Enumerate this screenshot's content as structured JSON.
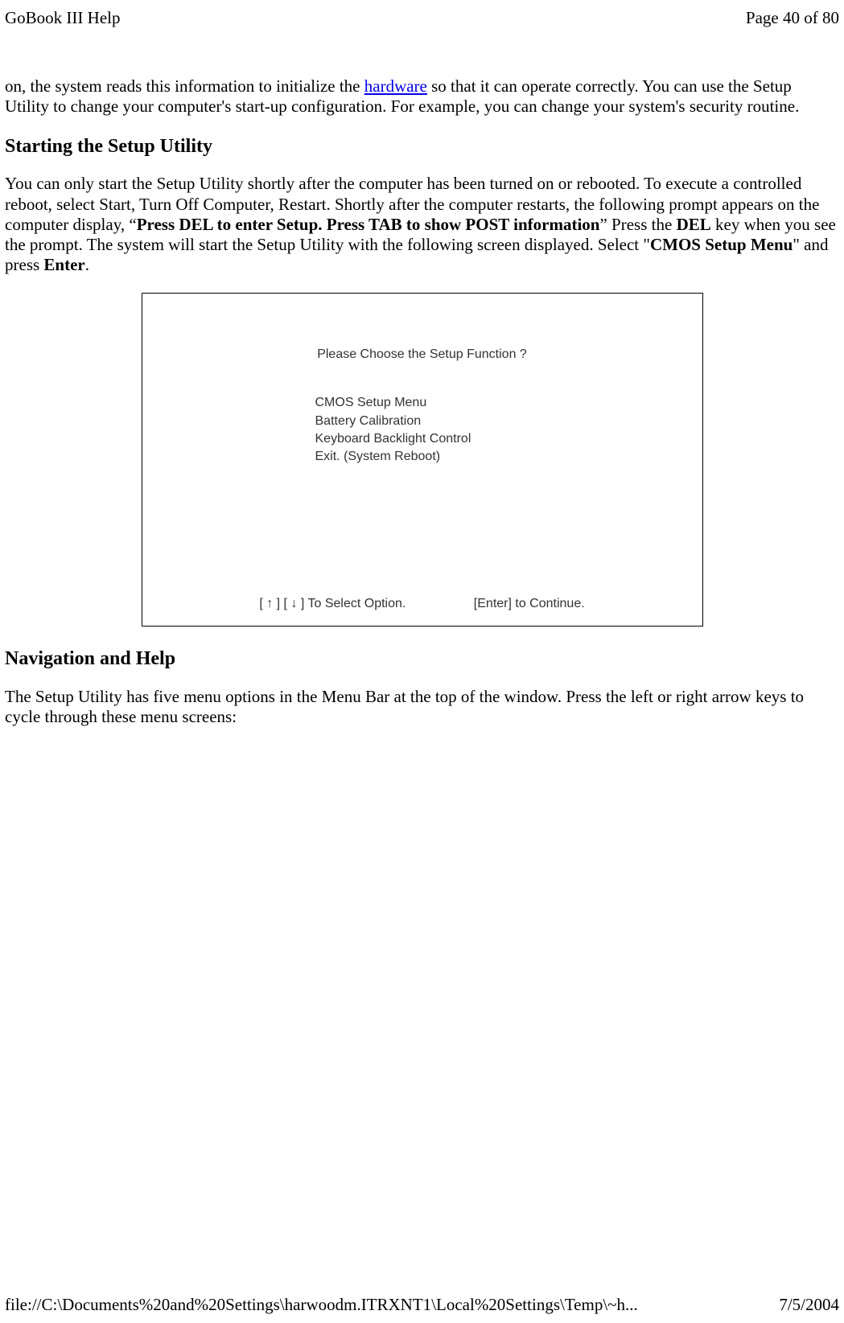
{
  "header": {
    "title": "GoBook III Help",
    "pageinfo": "Page 40 of 80"
  },
  "intro": {
    "text_before_link": "on, the system reads this information to initialize the ",
    "link_text": "hardware",
    "text_after_link": " so that it can operate correctly. You can use the Setup Utility to change your computer's start-up configuration. For example, you can change your system's security routine."
  },
  "section1": {
    "heading": "Starting the Setup Utility",
    "p1_a": "You can only start the Setup Utility shortly after the computer has been turned on or rebooted. To execute a controlled reboot, select Start, Turn Off Computer, Restart.  Shortly after the computer restarts, the following prompt appears on the computer display, “",
    "p1_bold1": "Press DEL to enter Setup. Press TAB to show POST information",
    "p1_b": "”  Press the ",
    "p1_bold2": "DEL",
    "p1_c": " key when you see the prompt.  The system will start the Setup Utility with the following screen displayed. Select \"",
    "p1_bold3": "CMOS Setup Menu",
    "p1_d": "\" and press ",
    "p1_bold4": "Enter",
    "p1_e": "."
  },
  "screenshot": {
    "title": "Please Choose the Setup Function ?",
    "item1": "CMOS Setup Menu",
    "item2": "Battery Calibration",
    "item3": "Keyboard  Backlight  Control",
    "item4": "Exit. (System Reboot)",
    "footer_left": "[ ↑ ]   [ ↓ ]   To Select Option.",
    "footer_right": "[Enter] to Continue."
  },
  "section2": {
    "heading": "Navigation and Help",
    "p1": "The Setup Utility has five menu options in the Menu Bar at the top of the window. Press the left or right arrow keys to cycle through these menu screens:"
  },
  "footer": {
    "path": "file://C:\\Documents%20and%20Settings\\harwoodm.ITRXNT1\\Local%20Settings\\Temp\\~h...",
    "date": "7/5/2004"
  }
}
